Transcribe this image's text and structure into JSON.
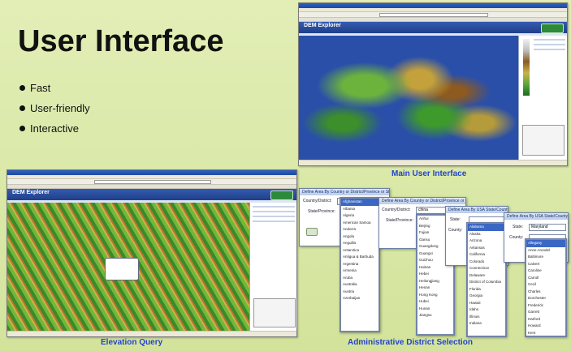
{
  "slide": {
    "title": "User Interface",
    "bullets": [
      "Fast",
      "User-friendly",
      "Interactive"
    ]
  },
  "captions": {
    "main_ui": "Main User Interface",
    "elevation_query": "Elevation Query",
    "elevation_prefix": "Elevation",
    "elevation_suffix": "Query",
    "admin_selection": "Administrative District Selection"
  },
  "app": {
    "title": "DEM Explorer"
  },
  "dialogs": {
    "country_state": {
      "header": "Define Area By Country or District/Province or State",
      "country_label": "Country/District:",
      "state_label": "State/Province:",
      "country_value": "",
      "list": [
        "Afghanistan",
        "Albania",
        "Algeria",
        "American Samoa",
        "Andorra",
        "Angola",
        "Anguilla",
        "Antarctica",
        "Antigua & Barbuda",
        "Argentina",
        "Armenia",
        "Aruba",
        "Australia",
        "Austria",
        "Azerbaijan"
      ]
    },
    "china": {
      "header": "Define Area By Country or District/Province or State",
      "country_label": "Country/District:",
      "state_label": "State/Province:",
      "country_value": "china",
      "list": [
        "Anhui",
        "Beijing",
        "Fujian",
        "Gansu",
        "Guangdong",
        "Guangxi",
        "Guizhou",
        "Hainan",
        "Hebei",
        "Heilongjiang",
        "Henan",
        "Hong Kong",
        "Hubei",
        "Hunan",
        "Jiangsu"
      ]
    },
    "usa_states": {
      "header": "Define Area By USA State/County",
      "state_label": "State:",
      "county_label": "County:",
      "list": [
        "Alabama",
        "Alaska",
        "Arizona",
        "Arkansas",
        "California",
        "Colorado",
        "Connecticut",
        "Delaware",
        "District of Columbia",
        "Florida",
        "Georgia",
        "Hawaii",
        "Idaho",
        "Illinois",
        "Indiana"
      ]
    },
    "maryland": {
      "header": "Define Area By USA State/County",
      "state_label": "State:",
      "county_label": "County:",
      "state_value": "Maryland",
      "list": [
        "Allegany",
        "Anne Arundel",
        "Baltimore",
        "Calvert",
        "Caroline",
        "Carroll",
        "Cecil",
        "Charles",
        "Dorchester",
        "Frederick",
        "Garrett",
        "Harford",
        "Howard",
        "Kent",
        "Montgomery"
      ]
    }
  },
  "colors": {
    "background": "#d9e8a8",
    "caption": "#2244cc",
    "app_header": "#1f3f88"
  }
}
